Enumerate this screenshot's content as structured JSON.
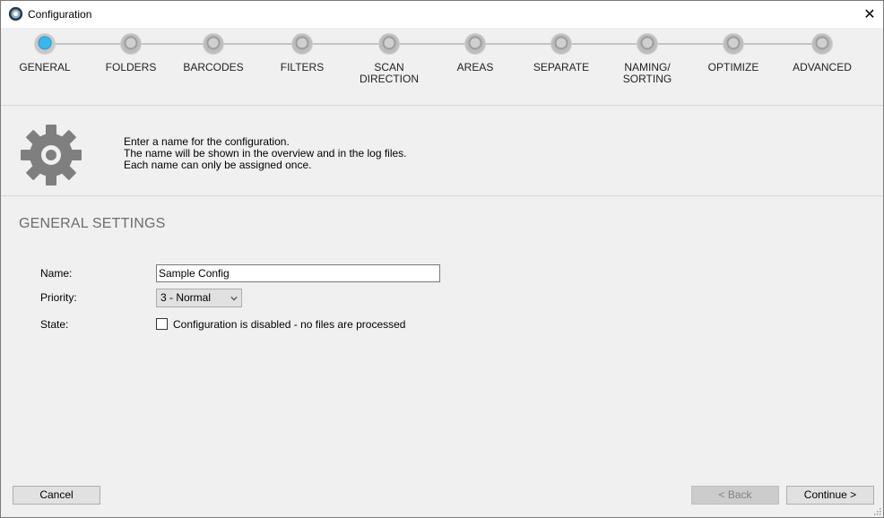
{
  "window": {
    "title": "Configuration",
    "close_glyph": "✕",
    "app_icon": "gear-app-icon"
  },
  "steps": [
    {
      "label": "GENERAL",
      "active": true
    },
    {
      "label": "FOLDERS",
      "active": false
    },
    {
      "label": "BARCODES",
      "active": false
    },
    {
      "label": "FILTERS",
      "active": false
    },
    {
      "label": "SCAN\nDIRECTION",
      "active": false
    },
    {
      "label": "AREAS",
      "active": false
    },
    {
      "label": "SEPARATE",
      "active": false
    },
    {
      "label": "NAMING/\nSORTING",
      "active": false
    },
    {
      "label": "OPTIMIZE",
      "active": false
    },
    {
      "label": "ADVANCED",
      "active": false
    }
  ],
  "info": {
    "icon": "gear-icon",
    "line1": "Enter a name for the configuration.",
    "line2": "The name will be shown in the overview and in the log files.",
    "line3": "Each name can only be assigned once."
  },
  "section": {
    "title": "GENERAL SETTINGS"
  },
  "form": {
    "name_label": "Name:",
    "name_value": "Sample Config",
    "priority_label": "Priority:",
    "priority_value": "3 - Normal",
    "state_label": "State:",
    "state_checkbox_label": "Configuration is disabled - no files are processed",
    "state_checked": false
  },
  "buttons": {
    "cancel": "Cancel",
    "back": "< Back",
    "continue": "Continue >"
  },
  "colors": {
    "active_step": "#1e95cf",
    "inactive_step": "#bdbdbd",
    "section_title": "#6d6d6d"
  }
}
